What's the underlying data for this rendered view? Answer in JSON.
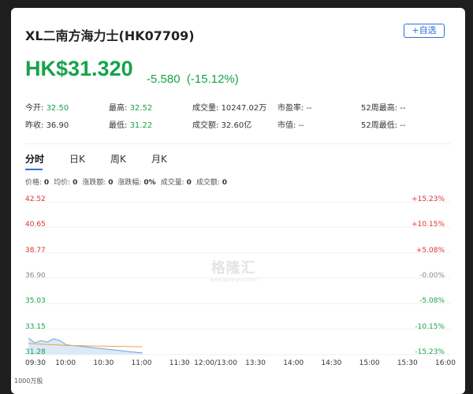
{
  "header": {
    "title": "XL二南方海力士(HK07709)",
    "watch_label": "+自选"
  },
  "quote": {
    "price": "HK$31.320",
    "change": "-5.580",
    "change_pct": "(-15.12%)"
  },
  "stats_row1": [
    {
      "label": "今开:",
      "value": "32.50",
      "color": "green"
    },
    {
      "label": "最高:",
      "value": "32.52",
      "color": "green"
    },
    {
      "label": "成交量:",
      "value": "10247.02万",
      "color": "plain"
    },
    {
      "label": "市盈率:",
      "value": "--",
      "color": "plain"
    },
    {
      "label": "52周最高:",
      "value": "--",
      "color": "plain"
    }
  ],
  "stats_row2": [
    {
      "label": "昨收:",
      "value": "36.90",
      "color": "plain"
    },
    {
      "label": "最低:",
      "value": "31.22",
      "color": "green"
    },
    {
      "label": "成交额:",
      "value": "32.60亿",
      "color": "plain"
    },
    {
      "label": "市值:",
      "value": "--",
      "color": "plain"
    },
    {
      "label": "52周最低:",
      "value": "--",
      "color": "plain"
    }
  ],
  "tabs": [
    "分时",
    "日K",
    "周K",
    "月K"
  ],
  "active_tab": "分时",
  "info_line": [
    {
      "label": "价格:",
      "value": "0"
    },
    {
      "label": "均价:",
      "value": "0"
    },
    {
      "label": "涨跌额:",
      "value": "0"
    },
    {
      "label": "涨跌幅:",
      "value": "0%"
    },
    {
      "label": "成交量:",
      "value": "0"
    },
    {
      "label": "成交额:",
      "value": "0"
    }
  ],
  "watermark": {
    "main": "格隆汇",
    "sub": "www.gelonghui.com"
  },
  "volume_label": "1000万股",
  "colors": {
    "up": "#e03131",
    "down": "#16a34a",
    "neutral": "#888888",
    "price_line": "#6aa3e0",
    "avg_line": "#f0a040",
    "accent": "#2f6fd6"
  },
  "chart_data": {
    "type": "line",
    "title": "",
    "xlabel": "",
    "ylabel": "",
    "y_ticks_left": [
      "42.52",
      "40.65",
      "38.77",
      "36.90",
      "35.03",
      "33.15",
      "31.28"
    ],
    "y_ticks_right": [
      "+15.23%",
      "+10.15%",
      "+5.08%",
      "-0.00%",
      "-5.08%",
      "-10.15%",
      "-15.23%"
    ],
    "x_ticks": [
      "09:30",
      "10:00",
      "10:30",
      "11:00",
      "11:30",
      "12:00/13:00",
      "13:30",
      "14:00",
      "14:30",
      "15:00",
      "15:30",
      "16:00"
    ],
    "ylim": [
      31.28,
      42.52
    ],
    "series": [
      {
        "name": "",
        "x": [
          "09:30",
          "09:35",
          "09:40",
          "09:45",
          "09:50",
          "09:55",
          "10:00",
          "10:05",
          "10:10",
          "10:15",
          "10:20",
          "10:25",
          "10:30",
          "10:35",
          "10:40",
          "10:45",
          "10:50",
          "10:55",
          "11:00"
        ],
        "values": [
          32.5,
          32.15,
          32.3,
          32.2,
          32.45,
          32.3,
          32.0,
          31.95,
          31.9,
          31.85,
          31.8,
          31.75,
          31.7,
          31.65,
          31.6,
          31.55,
          31.5,
          31.45,
          31.4
        ]
      },
      {
        "name": "",
        "x": [
          "09:30",
          "10:00",
          "10:30",
          "11:00"
        ],
        "values": [
          32.1,
          31.95,
          31.9,
          31.85
        ]
      }
    ]
  }
}
